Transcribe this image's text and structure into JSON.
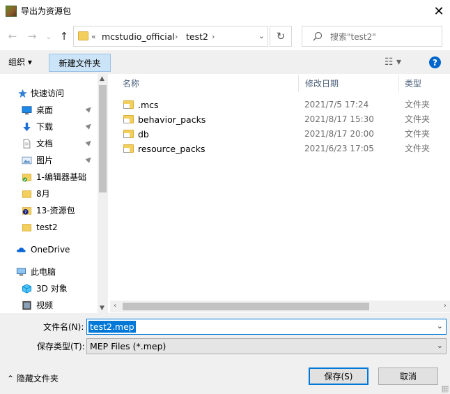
{
  "window": {
    "title": "导出为资源包",
    "close_symbol": "✕"
  },
  "nav": {
    "back_symbol": "←",
    "forward_symbol": "→",
    "recent_symbol": "⌄",
    "up_symbol": "↑",
    "breadcrumbs": [
      "«",
      "mcstudio_official",
      "›",
      "test2",
      "›"
    ],
    "refresh_symbol": "↻",
    "search_placeholder": "搜索\"test2\""
  },
  "toolbar": {
    "organize_label": "组织 ▾",
    "new_folder_label": "新建文件夹",
    "view_symbol": "☷ ▾",
    "help_symbol": "?"
  },
  "sidebar": {
    "items": [
      {
        "label": "快速访问",
        "icon": "star-icon"
      },
      {
        "label": "桌面",
        "icon": "desktop-icon",
        "pinned": true
      },
      {
        "label": "下载",
        "icon": "download-icon",
        "pinned": true
      },
      {
        "label": "文档",
        "icon": "document-icon",
        "pinned": true
      },
      {
        "label": "图片",
        "icon": "picture-icon",
        "pinned": true
      },
      {
        "label": "1-编辑器基础",
        "icon": "folder-check-icon"
      },
      {
        "label": "8月",
        "icon": "folder-icon"
      },
      {
        "label": "13-资源包",
        "icon": "folder-question-icon"
      },
      {
        "label": "test2",
        "icon": "folder-icon"
      },
      {
        "label": "OneDrive",
        "icon": "cloud-icon"
      },
      {
        "label": "此电脑",
        "icon": "computer-icon"
      },
      {
        "label": "3D 对象",
        "icon": "cube-icon"
      },
      {
        "label": "视频",
        "icon": "video-icon"
      }
    ],
    "pin_symbol": "📌"
  },
  "columns": {
    "name": "名称",
    "date": "修改日期",
    "type": "类型"
  },
  "files": [
    {
      "name": ".mcs",
      "date": "2021/7/5 17:24",
      "type": "文件夹"
    },
    {
      "name": "behavior_packs",
      "date": "2021/8/17 15:30",
      "type": "文件夹"
    },
    {
      "name": "db",
      "date": "2021/8/17 20:00",
      "type": "文件夹"
    },
    {
      "name": "resource_packs",
      "date": "2021/6/23 17:05",
      "type": "文件夹"
    }
  ],
  "form": {
    "filename_label": "文件名(N):",
    "filename_value": "test2.mep",
    "filetype_label": "保存类型(T):",
    "filetype_value": "MEP Files (*.mep)",
    "hide_folders_label": "⌃  隐藏文件夹",
    "save_label": "保存(S)",
    "cancel_label": "取消"
  },
  "colors": {
    "accent": "#0078d7",
    "new_folder_bg": "#cce4f7",
    "folder_yellow": "#f3cf5e",
    "chrome_bg": "#f0f0f0"
  }
}
